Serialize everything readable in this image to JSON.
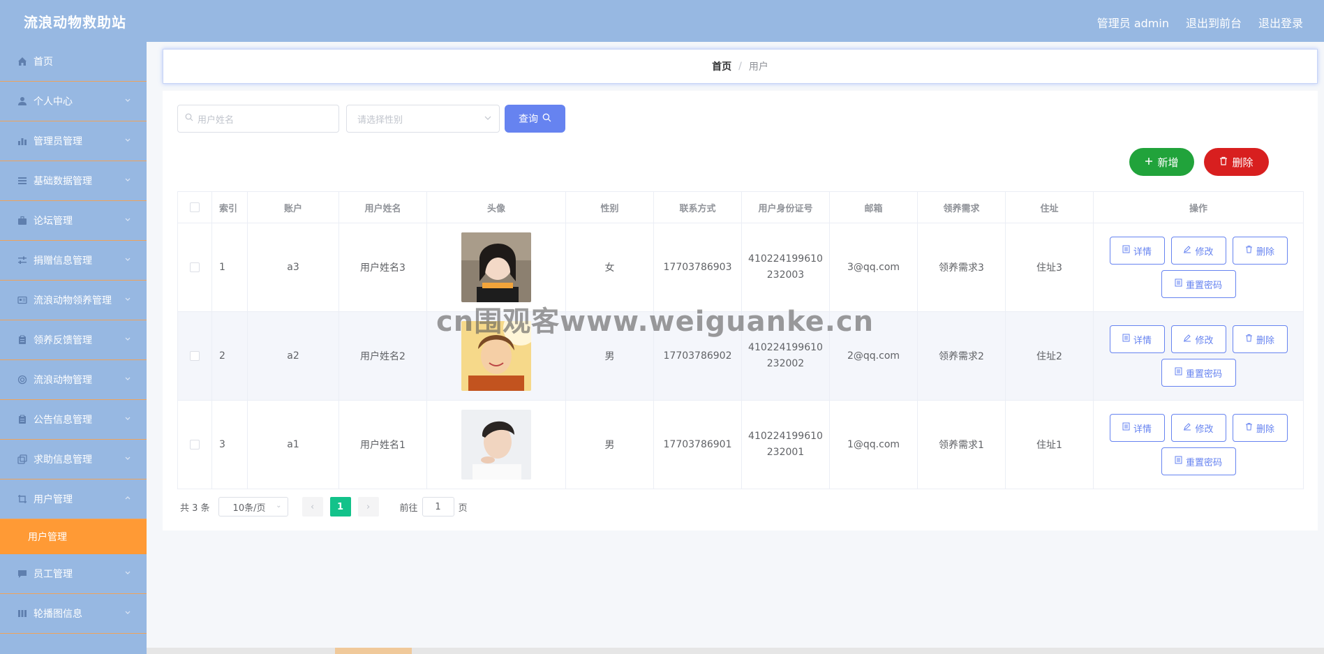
{
  "app": {
    "title": "流浪动物救助站",
    "admin_label": "管理员 admin",
    "to_front": "退出到前台",
    "logout": "退出登录"
  },
  "sidebar": {
    "items": [
      {
        "label": "首页",
        "icon": "home-icon"
      },
      {
        "label": "个人中心",
        "icon": "user-icon"
      },
      {
        "label": "管理员管理",
        "icon": "bar-chart-icon"
      },
      {
        "label": "基础数据管理",
        "icon": "list-icon"
      },
      {
        "label": "论坛管理",
        "icon": "briefcase-icon"
      },
      {
        "label": "捐赠信息管理",
        "icon": "sliders-icon"
      },
      {
        "label": "流浪动物领养管理",
        "icon": "id-card-icon"
      },
      {
        "label": "领养反馈管理",
        "icon": "clipboard-icon"
      },
      {
        "label": "流浪动物管理",
        "icon": "circle-icon"
      },
      {
        "label": "公告信息管理",
        "icon": "clipboard-icon"
      },
      {
        "label": "求助信息管理",
        "icon": "copy-icon"
      },
      {
        "label": "用户管理",
        "icon": "crop-icon"
      },
      {
        "label": "员工管理",
        "icon": "chat-icon"
      },
      {
        "label": "轮播图信息",
        "icon": "columns-icon"
      }
    ],
    "active_sub": "用户管理"
  },
  "breadcrumb": {
    "home": "首页",
    "separator": "/",
    "current": "用户"
  },
  "search": {
    "name_placeholder": "用户姓名",
    "gender_placeholder": "请选择性别",
    "query_label": "查询"
  },
  "toolbar": {
    "add_label": "新增",
    "delete_label": "删除"
  },
  "table": {
    "headers": [
      "索引",
      "账户",
      "用户姓名",
      "头像",
      "性别",
      "联系方式",
      "用户身份证号",
      "邮箱",
      "领养需求",
      "住址",
      "操作"
    ],
    "rows": [
      {
        "index": "1",
        "account": "a3",
        "name": "用户姓名3",
        "gender": "女",
        "phone": "17703786903",
        "id_line1": "410224199610",
        "id_line2": "232003",
        "email": "3@qq.com",
        "need": "领养需求3",
        "address": "住址3"
      },
      {
        "index": "2",
        "account": "a2",
        "name": "用户姓名2",
        "gender": "男",
        "phone": "17703786902",
        "id_line1": "410224199610",
        "id_line2": "232002",
        "email": "2@qq.com",
        "need": "领养需求2",
        "address": "住址2"
      },
      {
        "index": "3",
        "account": "a1",
        "name": "用户姓名1",
        "gender": "男",
        "phone": "17703786901",
        "id_line1": "410224199610",
        "id_line2": "232001",
        "email": "1@qq.com",
        "need": "领养需求1",
        "address": "住址1"
      }
    ],
    "ops": {
      "detail": "详情",
      "edit": "修改",
      "delete": "删除",
      "reset": "重置密码"
    }
  },
  "pager": {
    "total": "共 3 条",
    "page_size": "10条/页",
    "current_page": "1",
    "goto_prefix": "前往",
    "goto_value": "1",
    "goto_suffix": "页"
  },
  "watermark": "cn围观客www.weiguanke.cn",
  "colors": {
    "primary": "#6683f0",
    "sidebar": "#97b8e2",
    "accent": "#ff9a35",
    "add": "#21a33b",
    "delete": "#d81f1f",
    "pager_active": "#13c28a"
  }
}
